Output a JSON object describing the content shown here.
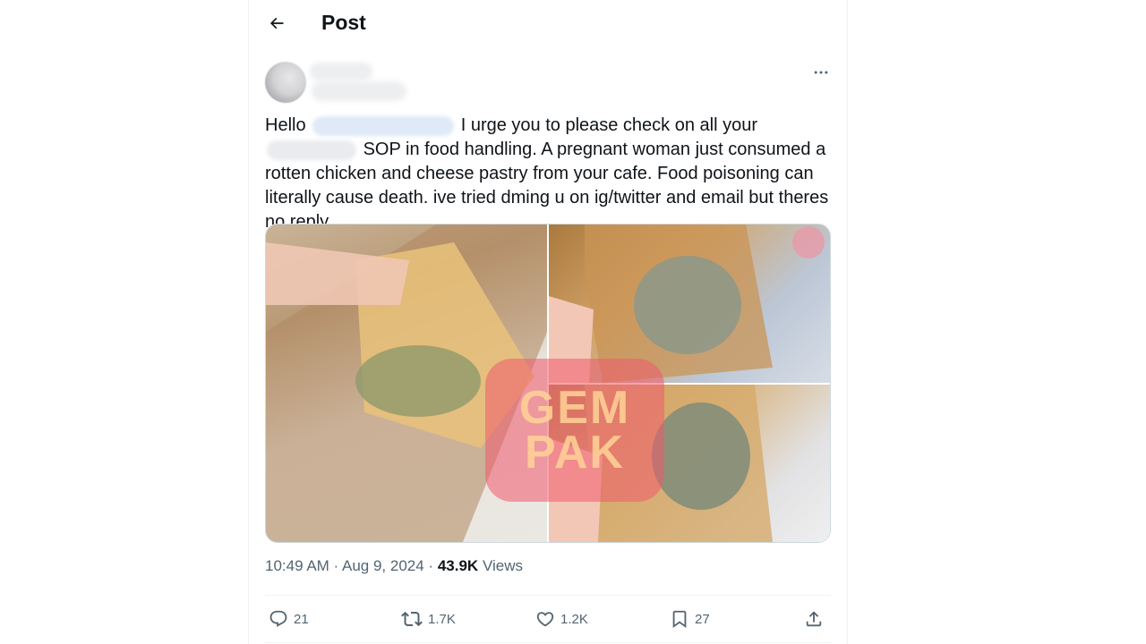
{
  "header": {
    "title": "Post",
    "back_icon": "arrow-left-icon"
  },
  "post": {
    "author_avatar": "blurred-avatar",
    "more_icon": "more-horizontal-icon",
    "text": {
      "greeting": "Hello",
      "line1_rest": "I urge you to please check on all your",
      "body": "SOP in food handling. A pregnant woman just consumed a rotten chicken and cheese pastry from your cafe. Food poisoning can literally cause death. ive tried dming u on ig/twitter and email but theres no reply."
    },
    "media": {
      "images": [
        {
          "description": "pastry-in-paper-bag"
        },
        {
          "description": "moldy-pastry-closeup-1"
        },
        {
          "description": "moldy-pastry-closeup-2"
        }
      ],
      "watermark_line1": "GEM",
      "watermark_line2": "PAK"
    },
    "timestamp": "10:49 AM · Aug 9, 2024",
    "separator": "·",
    "views_count": "43.9K",
    "views_label": "Views"
  },
  "actions": {
    "replies": "21",
    "reposts": "1.7K",
    "likes": "1.2K",
    "bookmarks": "27"
  },
  "colors": {
    "text_primary": "#0f1419",
    "text_secondary": "#536471",
    "border": "#eff3f4"
  }
}
